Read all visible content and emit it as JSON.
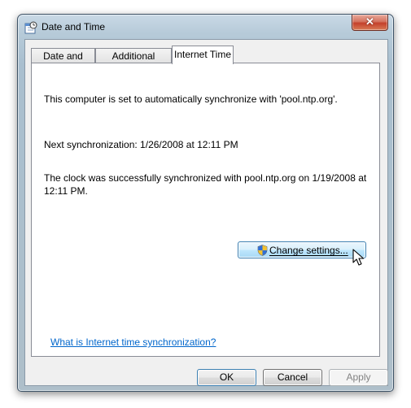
{
  "window": {
    "title": "Date and Time",
    "close_glyph": "✕"
  },
  "tabs": [
    {
      "label": "Date and Time",
      "active": false
    },
    {
      "label": "Additional Clocks",
      "active": false
    },
    {
      "label": "Internet Time",
      "active": true
    }
  ],
  "internet_time": {
    "sync_info": "This computer is set to automatically synchronize with 'pool.ntp.org'.",
    "next_sync": "Next synchronization: 1/26/2008 at 12:11 PM",
    "last_sync_line1": "The clock was successfully synchronized with pool.ntp.org on 1/19/2008 at",
    "last_sync_line2": "12:11 PM.",
    "change_settings_label": "Change settings...",
    "help_link": "What is Internet time synchronization?"
  },
  "buttons": {
    "ok": "OK",
    "cancel": "Cancel",
    "apply": "Apply"
  },
  "icons": {
    "title_icon": "clock-calendar-icon",
    "uac_shield": "uac-shield-icon",
    "cursor": "mouse-pointer-icon"
  },
  "colors": {
    "link": "#0066cc",
    "close_button": "#c4402a",
    "selected_button_border": "#3c7fb1"
  }
}
